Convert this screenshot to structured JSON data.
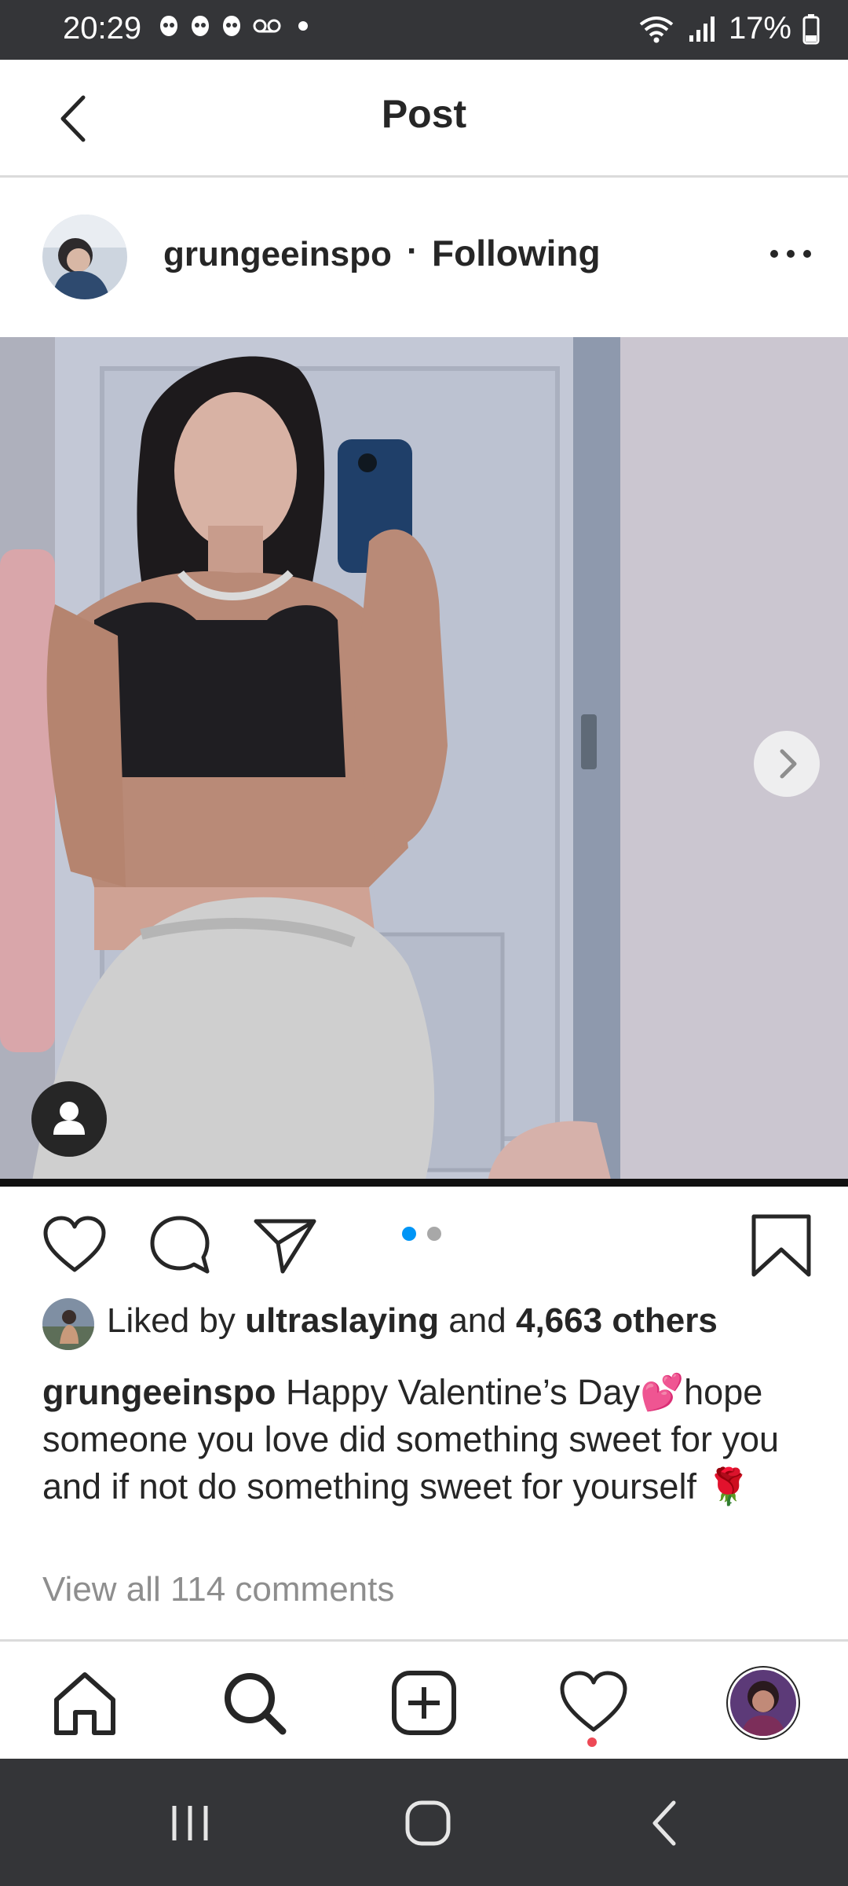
{
  "status_bar": {
    "time": "20:29",
    "battery": "17%",
    "notification_icons": [
      "eye-icon",
      "eye-icon",
      "eye-icon",
      "voicemail-icon",
      "dot-icon"
    ]
  },
  "header": {
    "title": "Post",
    "back_icon": "chevron-left-icon"
  },
  "post": {
    "author": "grungeeinspo",
    "separator": "·",
    "follow_status": "Following",
    "more_icon": "more-icon",
    "carousel": {
      "total": 2,
      "active": 1
    },
    "likes": {
      "prefix": "Liked by",
      "first_liker": "ultraslaying",
      "joiner": "and",
      "others": "4,663 others"
    },
    "caption": {
      "author": "grungeeinspo",
      "text": "Happy Valentine’s Day💕hope someone you love did something sweet for you and if not do something sweet for yourself 🌹"
    },
    "view_comments": "View all 114 comments"
  },
  "tab_bar": {
    "items": [
      "home-icon",
      "search-icon",
      "add-post-icon",
      "activity-icon",
      "profile-avatar"
    ]
  },
  "nav_bar": {
    "items": [
      "recent-apps-icon",
      "home-circle-icon",
      "back-icon"
    ]
  },
  "colors": {
    "status_bar_bg": "#343538",
    "nav_bar_bg": "#343538",
    "text": "#262626",
    "muted": "#8e8e8e",
    "accent_blue": "#0095f6",
    "dot_inactive": "#a8a8a8",
    "notification_red": "#ed4956"
  }
}
